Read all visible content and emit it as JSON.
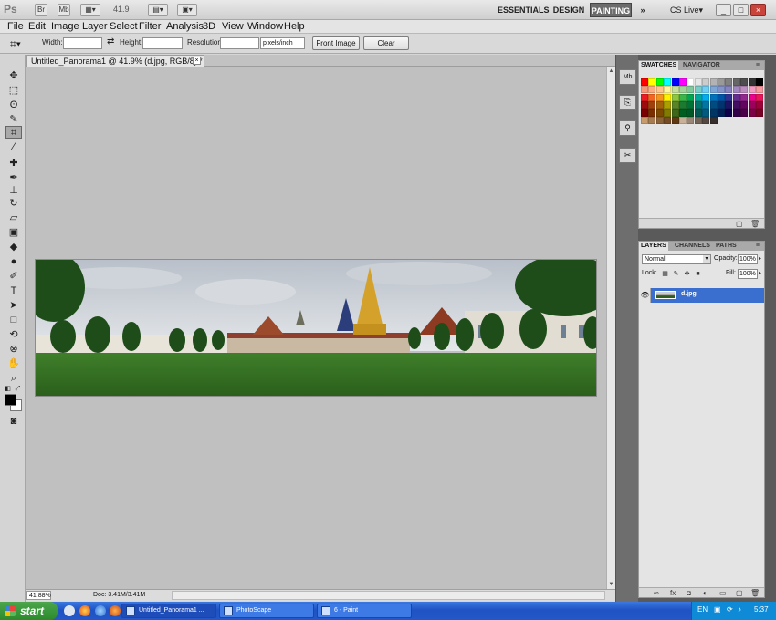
{
  "appbar": {
    "logo": "Ps",
    "zoom": "41.9",
    "workspaces": [
      "ESSENTIALS",
      "DESIGN",
      "PAINTING"
    ],
    "active_workspace": "PAINTING",
    "more": "»",
    "cs_live": "CS Live",
    "window_controls": [
      "_",
      "□",
      "×"
    ]
  },
  "menu": [
    "File",
    "Edit",
    "Image",
    "Layer",
    "Select",
    "Filter",
    "Analysis",
    "3D",
    "View",
    "Window",
    "Help"
  ],
  "options": {
    "width_label": "Width:",
    "width_value": "",
    "height_label": "Height:",
    "height_value": "",
    "resolution_label": "Resolution:",
    "resolution_value": "",
    "unit": "pixels/inch",
    "front_image": "Front Image",
    "clear": "Clear"
  },
  "document": {
    "tab_title": "Untitled_Panorama1 @ 41.9% (d.jpg, RGB/8) *",
    "close": "×",
    "zoom": "41.88%",
    "doc_size": "Doc: 3.41M/3.41M"
  },
  "panels": {
    "swatches_tabs": [
      "SWATCHES",
      "NAVIGATOR"
    ],
    "layers_tabs": [
      "LAYERS",
      "CHANNELS",
      "PATHS"
    ],
    "blend_mode": "Normal",
    "opacity_label": "Opacity:",
    "opacity": "100%",
    "lock_label": "Lock:",
    "fill_label": "Fill:",
    "fill": "100%",
    "layer_name": "d.jpg"
  },
  "swatches": {
    "colors": [
      "#ff0000",
      "#ffff00",
      "#00ff00",
      "#00ffff",
      "#0000ff",
      "#ff00ff",
      "#ffffff",
      "#e6e6e6",
      "#cccccc",
      "#b3b3b3",
      "#999999",
      "#808080",
      "#666666",
      "#4d4d4d",
      "#333333",
      "#000000",
      "#f7977a",
      "#f9ad81",
      "#fdc68a",
      "#fff79a",
      "#c4df9b",
      "#a2d39c",
      "#82ca9d",
      "#7bcdc8",
      "#6ecff6",
      "#7ea7d8",
      "#8493ca",
      "#8882be",
      "#a187be",
      "#bc8dbf",
      "#f49ac2",
      "#f6989d",
      "#ed1c24",
      "#f26522",
      "#f7941d",
      "#fff200",
      "#8dc73f",
      "#39b54a",
      "#00a651",
      "#00a99d",
      "#00aeef",
      "#0072bc",
      "#0054a6",
      "#2e3192",
      "#662d91",
      "#92278f",
      "#ec008c",
      "#ed145b",
      "#9e0b0f",
      "#a0410d",
      "#a36209",
      "#aba000",
      "#598527",
      "#1a7b30",
      "#007236",
      "#00746b",
      "#0076a3",
      "#004b80",
      "#003471",
      "#1b1464",
      "#440e62",
      "#630460",
      "#9e005d",
      "#9e0039",
      "#790000",
      "#7b2e00",
      "#7d4900",
      "#827b00",
      "#406618",
      "#005e20",
      "#005826",
      "#005952",
      "#005b7f",
      "#003663",
      "#002157",
      "#0d004c",
      "#32004b",
      "#4b0049",
      "#7b0046",
      "#7a0026",
      "#c69c6d",
      "#a67c52",
      "#8c6239",
      "#754c24",
      "#603913",
      "#c7b299",
      "#998675",
      "#736357",
      "#534741",
      "#362f2d"
    ]
  },
  "taskbar": {
    "start": "start",
    "tasks": [
      "Untitled_Panorama1 ...",
      "PhotoScape",
      "6 - Paint"
    ],
    "lang": "EN",
    "time": "5:37"
  }
}
